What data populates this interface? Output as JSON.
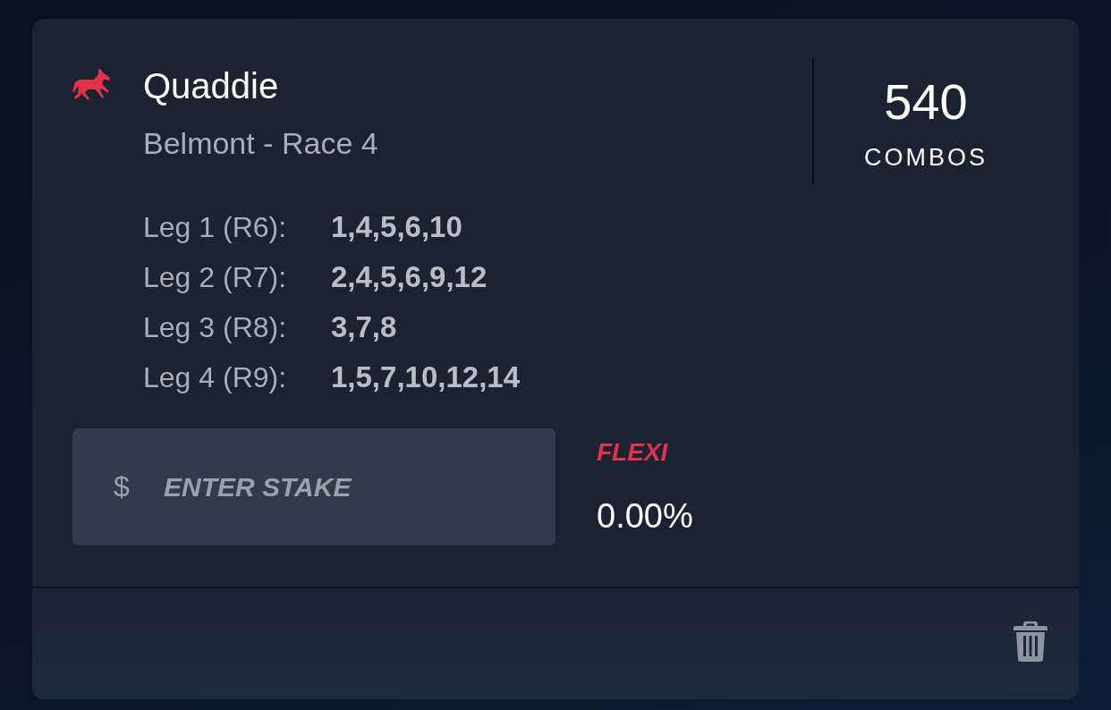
{
  "bet": {
    "title": "Quaddie",
    "subtitle": "Belmont - Race 4",
    "combos": {
      "value": "540",
      "label": "COMBOS"
    },
    "legs": [
      {
        "label": "Leg 1 (R6):",
        "runners": "1,4,5,6,10"
      },
      {
        "label": "Leg 2 (R7):",
        "runners": "2,4,5,6,9,12"
      },
      {
        "label": "Leg 3 (R8):",
        "runners": "3,7,8"
      },
      {
        "label": "Leg 4 (R9):",
        "runners": "1,5,7,10,12,14"
      }
    ],
    "stake": {
      "currency": "$",
      "placeholder": "ENTER STAKE"
    },
    "flexi": {
      "label": "FLEXI",
      "value": "0.00%"
    }
  }
}
